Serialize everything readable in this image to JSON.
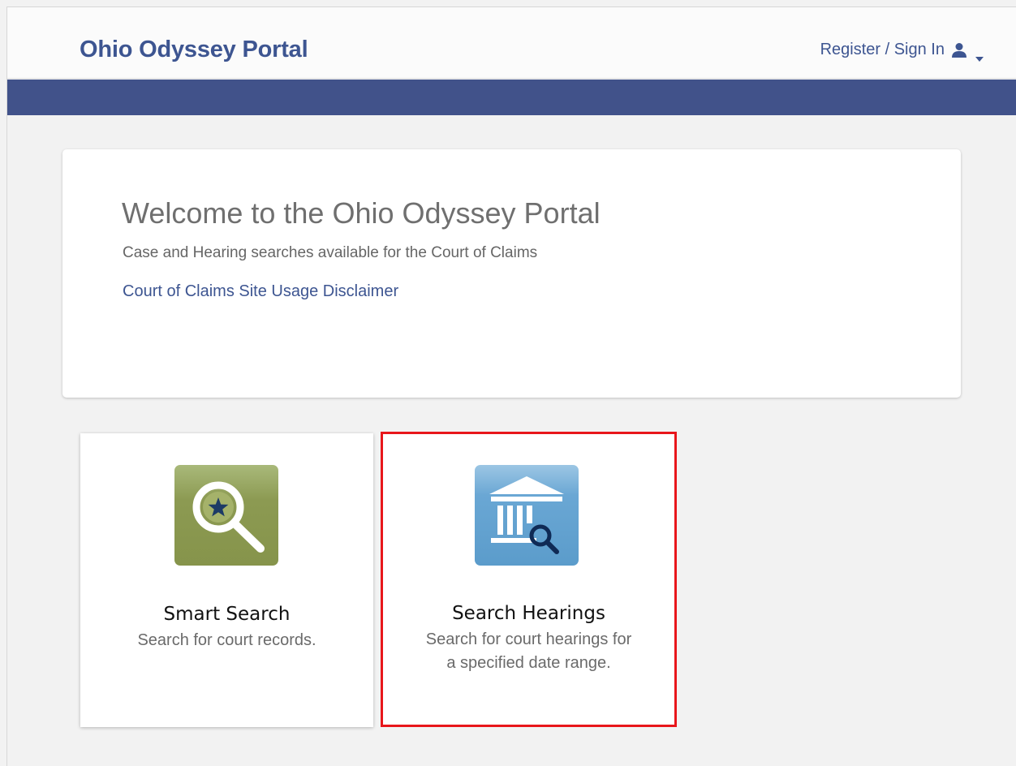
{
  "header": {
    "brand": "Ohio Odyssey Portal",
    "signin_label": "Register / Sign In",
    "user_icon": "user-icon",
    "caret_icon": "caret-down-icon"
  },
  "welcome": {
    "title": "Welcome to the Ohio Odyssey Portal",
    "subtitle": "Case and Hearing searches available for the Court of Claims",
    "disclaimer_link": "Court of Claims Site Usage Disclaimer"
  },
  "tiles": [
    {
      "title": "Smart Search",
      "description": "Search for court records.",
      "icon": "magnifier-star-icon",
      "icon_color": "#8b9a4e"
    },
    {
      "title": "Search Hearings",
      "description": "Search for court hearings for a specified date range.",
      "icon": "courthouse-search-icon",
      "icon_color": "#5a9dcb",
      "highlighted": true
    }
  ],
  "colors": {
    "brand": "#3d5591",
    "nav_bar": "#41528a",
    "highlight": "#e8161b"
  }
}
